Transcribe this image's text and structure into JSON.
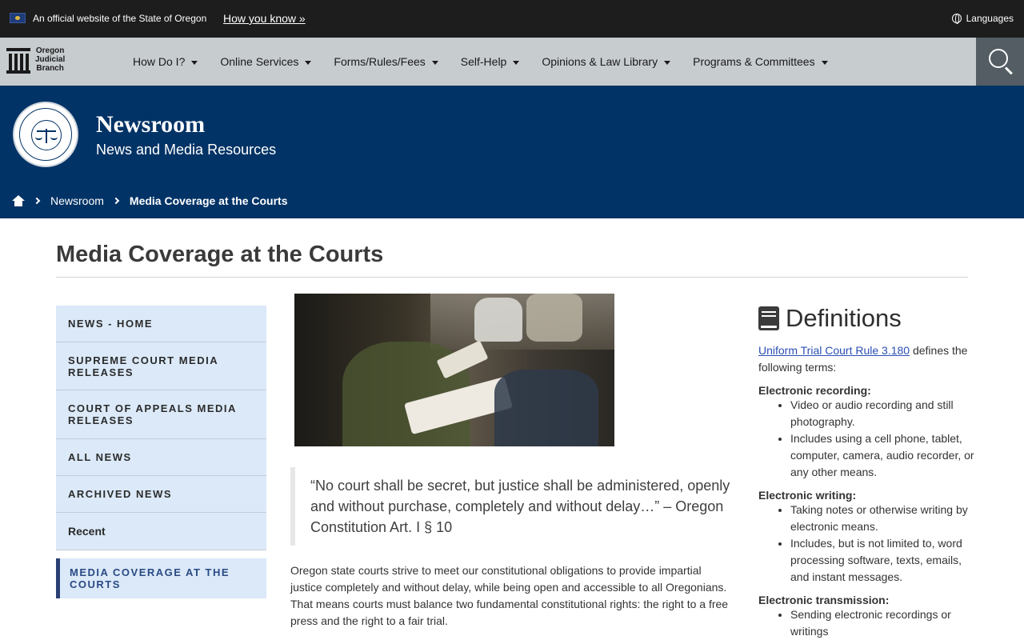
{
  "gov_bar": {
    "official_text": "An official website of the State of Oregon",
    "how_link": "How you know »",
    "languages": "Languages"
  },
  "nav": {
    "logo_lines": [
      "Oregon",
      "Judicial",
      "Branch"
    ],
    "items": [
      "How Do I?",
      "Online Services",
      "Forms/Rules/Fees",
      "Self-Help",
      "Opinions & Law Library",
      "Programs & Committees"
    ]
  },
  "hero": {
    "title": "Newsroom",
    "subtitle": "News and Media Resources",
    "breadcrumb": [
      "Newsroom",
      "Media Coverage at the Courts"
    ]
  },
  "page": {
    "title": "Media Coverage at the Courts"
  },
  "side_nav": {
    "items": [
      {
        "label": "NEWS - HOME"
      },
      {
        "label": "SUPREME COURT MEDIA RELEASES"
      },
      {
        "label": "COURT OF APPEALS MEDIA RELEASES"
      },
      {
        "label": "ALL NEWS"
      },
      {
        "label": "ARCHIVED NEWS"
      },
      {
        "label": "Recent"
      },
      {
        "label": "MEDIA COVERAGE AT THE COURTS"
      }
    ]
  },
  "main": {
    "quote": "“No court shall be secret, but justice shall be administered, openly and without purchase, completely and without delay…” – Oregon Constitution Art. I § 10",
    "body": "Oregon state courts strive to meet our constitutional obligations to provide impartial justice completely and without delay, while being open and accessible to all Oregonians. That means courts must balance two fundamental constitutional rights: the right to a free press and the right to a fair trial."
  },
  "definitions": {
    "heading": "Definitions",
    "rule_link": "Uniform Trial Court Rule 3.180",
    "intro_rest": " defines the following terms:",
    "terms": [
      {
        "term": "Electronic recording:",
        "items": [
          "Video or audio recording and still photography.",
          "Includes using a cell phone, tablet, computer, camera, audio recorder, or any other means."
        ]
      },
      {
        "term": "Electronic writing:",
        "items": [
          "Taking notes or otherwise writing by electronic means.",
          "Includes, but is not limited to, word processing software, texts, emails, and instant messages."
        ]
      },
      {
        "term": "Electronic transmission:",
        "items": [
          "Sending electronic recordings or writings"
        ]
      }
    ]
  }
}
